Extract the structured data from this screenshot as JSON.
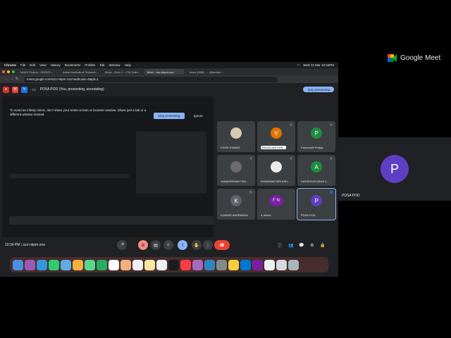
{
  "menubar": {
    "items": [
      "Chrome",
      "File",
      "Edit",
      "View",
      "History",
      "Bookmarks",
      "Profiles",
      "Tab",
      "Window",
      "Help"
    ],
    "datetime": "Wed 12 Mar 10:34PM"
  },
  "tabs": [
    {
      "label": "MAD2 Project - 23f2002..."
    },
    {
      "label": "Indian Institute of Technolo..."
    },
    {
      "label": "Mock - Quiz-2 :: ITM Onlin..."
    },
    {
      "label": "Meet - ozz-nkpm-zoo"
    },
    {
      "label": "Inbox (998) - ... @studen..."
    }
  ],
  "url": "meet.google.com/ozz-nkpm-zoo?authuser=0&pli=1",
  "presenting": {
    "title": "PDSA POD (You, presenting, annotating)",
    "stop_label": "Stop presenting"
  },
  "mirror_warning": {
    "text": "To avoid an infinity mirror, don't share your entire screen or browser window. Share just a tab or a different window instead.",
    "stop_label": "Stop presenting",
    "ignore_label": "Ignore"
  },
  "participants": [
    {
      "name": "VIVEK KUMAR",
      "initial": "",
      "color": "#d9c9b0"
    },
    {
      "name": "23f1001483 KAB...",
      "initial": "V",
      "color": "#e37400"
    },
    {
      "name": "Paramvalli Pratap",
      "initial": "P",
      "color": "#1e8e3e"
    },
    {
      "name": "JANAKRDHAN PAN...",
      "initial": "",
      "color": "#6b6b6b"
    },
    {
      "name": "DHARMANTARI ASH...",
      "initial": "",
      "color": "#eaeaea"
    },
    {
      "name": "24f1002143 ASHA C...",
      "initial": "A",
      "color": "#1e8e3e"
    },
    {
      "name": "KUMARI ANURADHA",
      "initial": "K",
      "color": "#5f6368"
    },
    {
      "name": "4 others",
      "initial": "F N",
      "color": "#7b1fa2"
    },
    {
      "name": "PDSA POD",
      "initial": "P",
      "color": "#5e3fc4"
    }
  ],
  "meetbar": {
    "time": "10:34 PM",
    "code": "ozz-nkpm-zoo"
  },
  "brand": "Google Meet",
  "self": {
    "name": "PDSA POD",
    "initial": "P"
  }
}
